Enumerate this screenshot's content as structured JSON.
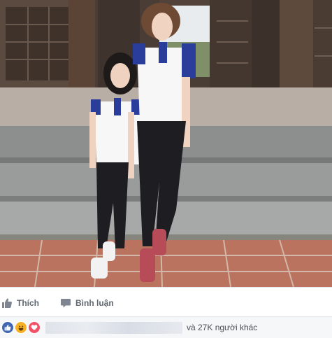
{
  "post": {
    "photo_alt": "",
    "actions": [
      {
        "label": "Thích",
        "icon": "like-icon"
      },
      {
        "label": "Bình luận",
        "icon": "comment-icon"
      }
    ],
    "reactions": {
      "icons": [
        "like-reaction-icon",
        "haha-reaction-icon",
        "love-reaction-icon"
      ],
      "others_text": "và 27K người khác"
    }
  },
  "colors": {
    "like_blue": "#4267b2",
    "haha_yellow": "#f7b125",
    "love_red": "#f25268",
    "action_text": "#606770",
    "bar_background": "#f6f7f9"
  }
}
